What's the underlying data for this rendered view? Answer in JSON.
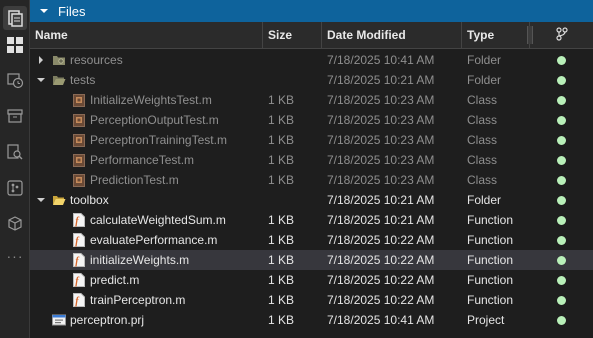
{
  "panel": {
    "title": "Files"
  },
  "columns": {
    "name": "Name",
    "size": "Size",
    "date": "Date Modified",
    "type": "Type"
  },
  "rows": [
    {
      "name": "resources",
      "size": "",
      "date": "7/18/2025 10:41 AM",
      "type": "Folder",
      "depth": 0,
      "kind": "folder-closed",
      "dim": true
    },
    {
      "name": "tests",
      "size": "",
      "date": "7/18/2025 10:21 AM",
      "type": "Folder",
      "depth": 0,
      "kind": "folder-open",
      "dim": true
    },
    {
      "name": "InitializeWeightsTest.m",
      "size": "1 KB",
      "date": "7/18/2025 10:23 AM",
      "type": "Class",
      "depth": 1,
      "kind": "class",
      "dim": true
    },
    {
      "name": "PerceptionOutputTest.m",
      "size": "1 KB",
      "date": "7/18/2025 10:23 AM",
      "type": "Class",
      "depth": 1,
      "kind": "class",
      "dim": true
    },
    {
      "name": "PerceptronTrainingTest.m",
      "size": "1 KB",
      "date": "7/18/2025 10:23 AM",
      "type": "Class",
      "depth": 1,
      "kind": "class",
      "dim": true
    },
    {
      "name": "PerformanceTest.m",
      "size": "1 KB",
      "date": "7/18/2025 10:23 AM",
      "type": "Class",
      "depth": 1,
      "kind": "class",
      "dim": true
    },
    {
      "name": "PredictionTest.m",
      "size": "1 KB",
      "date": "7/18/2025 10:23 AM",
      "type": "Class",
      "depth": 1,
      "kind": "class",
      "dim": true
    },
    {
      "name": "toolbox",
      "size": "",
      "date": "7/18/2025 10:21 AM",
      "type": "Folder",
      "depth": 0,
      "kind": "folder-open-yellow",
      "dim": false
    },
    {
      "name": "calculateWeightedSum.m",
      "size": "1 KB",
      "date": "7/18/2025 10:21 AM",
      "type": "Function",
      "depth": 1,
      "kind": "function",
      "dim": false
    },
    {
      "name": "evaluatePerformance.m",
      "size": "1 KB",
      "date": "7/18/2025 10:22 AM",
      "type": "Function",
      "depth": 1,
      "kind": "function",
      "dim": false
    },
    {
      "name": "initializeWeights.m",
      "size": "1 KB",
      "date": "7/18/2025 10:22 AM",
      "type": "Function",
      "depth": 1,
      "kind": "function",
      "dim": false,
      "selected": true
    },
    {
      "name": "predict.m",
      "size": "1 KB",
      "date": "7/18/2025 10:22 AM",
      "type": "Function",
      "depth": 1,
      "kind": "function",
      "dim": false
    },
    {
      "name": "trainPerceptron.m",
      "size": "1 KB",
      "date": "7/18/2025 10:22 AM",
      "type": "Function",
      "depth": 1,
      "kind": "function",
      "dim": false
    },
    {
      "name": "perceptron.prj",
      "size": "1 KB",
      "date": "7/18/2025 10:41 AM",
      "type": "Project",
      "depth": 0,
      "kind": "project",
      "dim": false
    }
  ],
  "icons": {
    "activity": [
      "files-icon",
      "layout-grid-icon",
      "history-icon",
      "archive-icon",
      "find-files-icon",
      "source-control-icon",
      "packages-icon"
    ],
    "git_status": "up-to-date-dot",
    "header_git": "git-branch-icon"
  },
  "colors": {
    "accent": "#0e639c",
    "status_dot": "#b9f0b9",
    "folder": "#e8c547",
    "function_icon": "#d9662a"
  }
}
